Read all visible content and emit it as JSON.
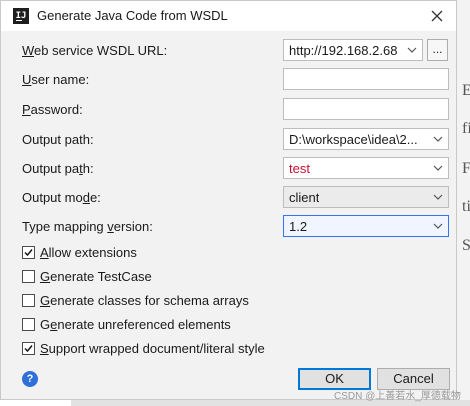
{
  "window": {
    "title": "Generate Java Code from WSDL"
  },
  "fields": {
    "wsdl_url": {
      "label_pre": "",
      "label_mn": "W",
      "label_post": "eb service WSDL URL:",
      "value": "http://192.168.2.68"
    },
    "user_name": {
      "label_pre": "",
      "label_mn": "U",
      "label_post": "ser name:",
      "value": ""
    },
    "password": {
      "label_pre": "",
      "label_mn": "P",
      "label_post": "assword:",
      "value": ""
    },
    "output_path": {
      "label_pre": "Output path:",
      "value": "D:\\workspace\\idea\\2..."
    },
    "output_package": {
      "label_pre": "Output pa",
      "label_mn": "t",
      "label_post": "h:",
      "value": "test",
      "value_color": "#c8102e"
    },
    "output_mode": {
      "label_pre": "Output mo",
      "label_mn": "d",
      "label_post": "e:",
      "value": "client"
    },
    "type_mapping": {
      "label_pre": "Type mapping ",
      "label_mn": "v",
      "label_post": "ersion:",
      "value": "1.2"
    }
  },
  "browse_button": "...",
  "options": [
    {
      "pre": "",
      "mn": "A",
      "post": "llow extensions",
      "checked": true
    },
    {
      "pre": "",
      "mn": "G",
      "post": "enerate TestCase",
      "checked": false
    },
    {
      "pre": "",
      "mn": "G",
      "post": "enerate classes for schema arrays",
      "checked": false
    },
    {
      "pre": "G",
      "mn": "e",
      "post": "nerate unreferenced elements",
      "checked": false
    },
    {
      "pre": "",
      "mn": "S",
      "post": "upport wrapped document/literal style",
      "checked": true
    }
  ],
  "buttons": {
    "help": "?",
    "ok": "OK",
    "cancel": "Cancel"
  },
  "background_letters": [
    "E",
    "fi",
    "F",
    "ti",
    "S"
  ],
  "watermark": "CSDN @上善若水_厚德载物",
  "icons": {
    "app": "intellij-icon",
    "close": "close-icon",
    "dropdown": "chevron-down-icon",
    "check": "checkmark-icon",
    "help": "help-icon"
  },
  "colors": {
    "accent": "#3574f0",
    "error_text": "#c8102e",
    "help": "#2f6fda"
  }
}
